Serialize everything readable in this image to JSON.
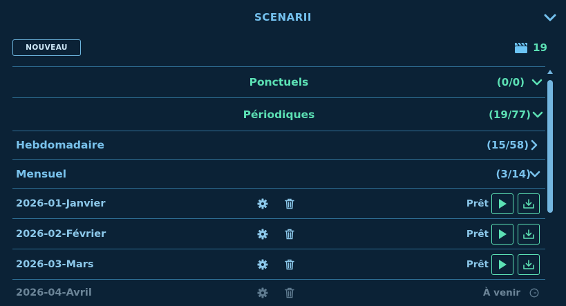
{
  "header": {
    "title": "SCENARII"
  },
  "toolbar": {
    "new_label": "NOUVEAU",
    "scenario_count": "19"
  },
  "sections": [
    {
      "label": "Ponctuels",
      "count": "(0/0)"
    },
    {
      "label": "Périodiques",
      "count": "(19/77)"
    }
  ],
  "groups": [
    {
      "label": "Hebdomadaire",
      "count": "(15/58)"
    },
    {
      "label": "Mensuel",
      "count": "(3/14)"
    }
  ],
  "items": [
    {
      "label": "2026-01-Janvier",
      "status": "Prêt"
    },
    {
      "label": "2026-02-Février",
      "status": "Prêt"
    },
    {
      "label": "2026-03-Mars",
      "status": "Prêt"
    },
    {
      "label": "2026-04-Avril",
      "status": "À venir"
    }
  ],
  "colors": {
    "accent": "#5ce0b4",
    "primary": "#79c2ec",
    "background": "#0b2236",
    "divider": "#2f6f95"
  }
}
